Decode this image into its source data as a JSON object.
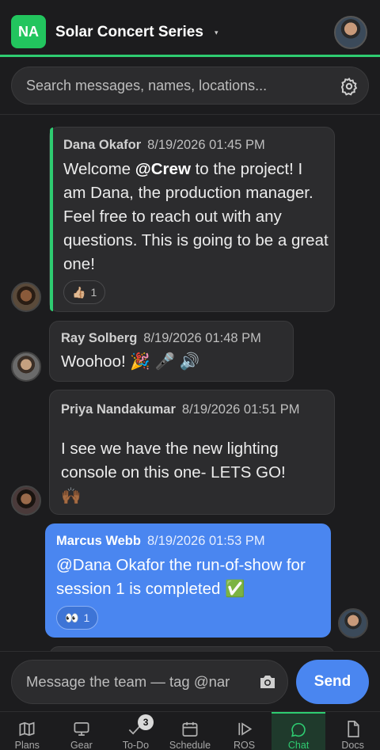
{
  "header": {
    "badge": "NA",
    "title": "Solar Concert Series",
    "caret": "▾"
  },
  "search": {
    "placeholder": "Search messages, names, locations..."
  },
  "messages": [
    {
      "author": "Dana Okafor",
      "timestamp": "8/19/2026 01:45 PM",
      "text_pre": "Welcome ",
      "mention": "@Crew",
      "text_post": " to the project! I am Dana, the production manager. Feel free to reach out with any questions. This is going to be a great one!",
      "reaction": {
        "emoji": "👍🏼",
        "count": "1"
      }
    },
    {
      "author": "Ray Solberg",
      "timestamp": "8/19/2026 01:48 PM",
      "text": "Woohoo! 🎉 🎤 🔊"
    },
    {
      "author": "Priya Nandakumar",
      "timestamp": "8/19/2026 01:51 PM",
      "text": "I see we have the new lighting console on this one- LETS GO!",
      "emoji_line": "🙌🏾"
    },
    {
      "author": "Marcus Webb",
      "timestamp": "8/19/2026 01:53 PM",
      "text": "@Dana Okafor the run-of-show for session 1 is completed ✅",
      "reaction": {
        "emoji": "👀",
        "count": "1"
      }
    }
  ],
  "compose": {
    "placeholder": "Message the team — tag @nar",
    "send_label": "Send"
  },
  "tabs": [
    {
      "label": "Plans",
      "icon": "map-icon"
    },
    {
      "label": "Gear",
      "icon": "monitor-icon"
    },
    {
      "label": "To-Do",
      "icon": "check-icon",
      "badge": "3"
    },
    {
      "label": "Schedule",
      "icon": "calendar-icon"
    },
    {
      "label": "ROS",
      "icon": "play-icon"
    },
    {
      "label": "Chat",
      "icon": "chat-icon",
      "active": true
    },
    {
      "label": "Docs",
      "icon": "document-icon"
    }
  ],
  "colors": {
    "brand_green": "#2ecc71",
    "own_message_blue": "#4a86f0",
    "background": "#1c1c1e"
  }
}
